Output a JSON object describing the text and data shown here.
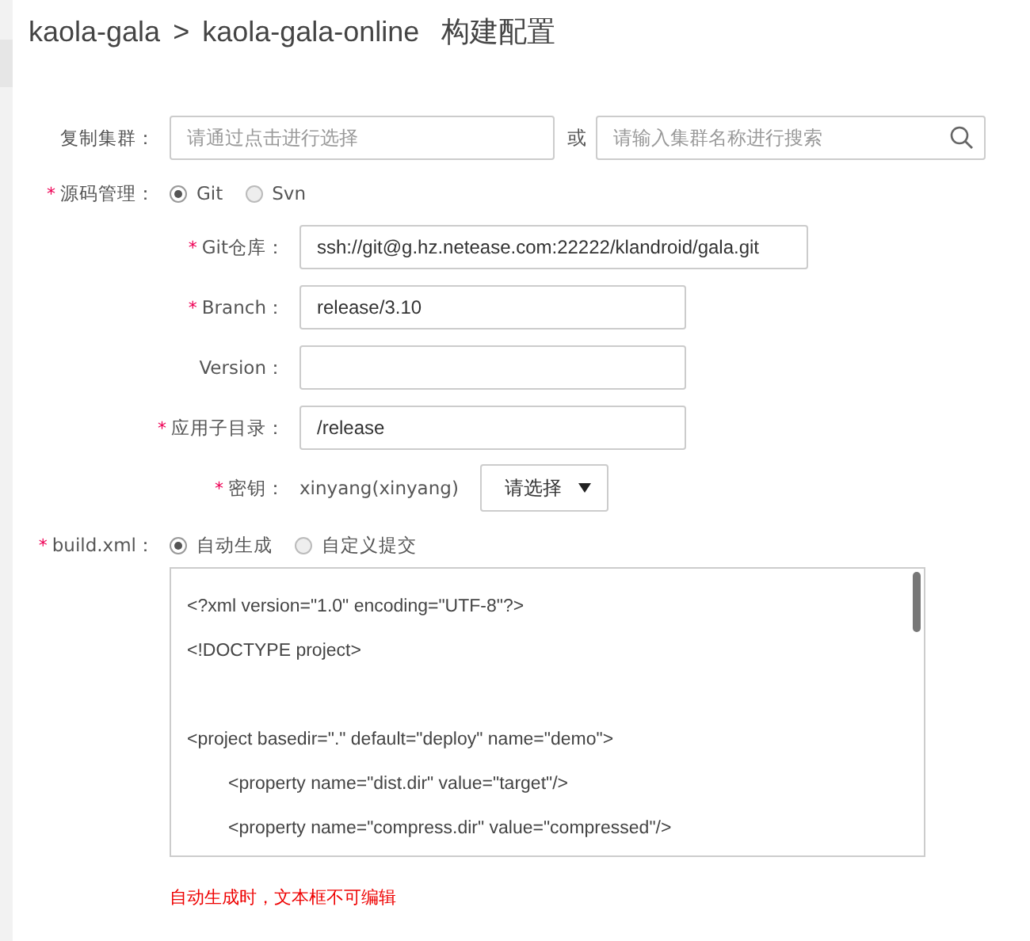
{
  "breadcrumb": {
    "items": [
      "kaola-gala",
      "kaola-gala-online"
    ],
    "separator": ">",
    "title": "构建配置"
  },
  "copy_cluster": {
    "label": "复制集群：",
    "select_placeholder": "请通过点击进行选择",
    "or": "或",
    "search_placeholder": "请输入集群名称进行搜索"
  },
  "source": {
    "label": "源码管理：",
    "required_mark": "*",
    "options": [
      {
        "label": "Git",
        "selected": true
      },
      {
        "label": "Svn",
        "selected": false
      }
    ]
  },
  "git_fields": [
    {
      "kind": "long_input",
      "label": "Git仓库：",
      "required_mark": "*",
      "value": "ssh://git@g.hz.netease.com:22222/klandroid/gala.git"
    },
    {
      "kind": "input",
      "label": "Branch：",
      "required_mark": "*",
      "value": "release/3.10"
    },
    {
      "kind": "input",
      "label": "Version："
    },
    {
      "kind": "input",
      "label": "应用子目录：",
      "required_mark": "*",
      "value": "/release"
    },
    {
      "kind": "key",
      "label": "密钥：",
      "required_mark": "*",
      "text": "xinyang(xinyang)",
      "select": "请选择"
    }
  ],
  "build": {
    "label": "build.xml：",
    "required_mark": "*",
    "options": [
      {
        "label": "自动生成",
        "selected": true
      },
      {
        "label": "自定义提交",
        "selected": false
      }
    ],
    "lines": [
      {
        "kind": "top",
        "text": "<?xml version=\"1.0\" encoding=\"UTF-8\"?>"
      },
      {
        "kind": "top",
        "text": "<!DOCTYPE project>"
      },
      {
        "kind": "blank"
      },
      {
        "kind": "top",
        "text": "<project basedir=\".\" default=\"deploy\" name=\"demo\">"
      },
      {
        "kind": "nested",
        "text": "<property name=\"dist.dir\" value=\"target\"/>"
      },
      {
        "kind": "nested",
        "text": "<property name=\"compress.dir\" value=\"compressed\"/>"
      }
    ],
    "note": "自动生成时，文本框不可编辑"
  }
}
